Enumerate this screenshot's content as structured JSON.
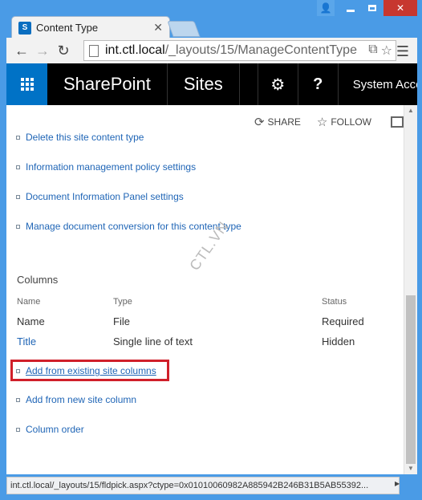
{
  "browser": {
    "tab_title": "Content Type",
    "tab_favicon": "S",
    "url_host": "int.ctl.local",
    "url_path": "/_layouts/15/ManageContentType",
    "status_url": "int.ctl.local/_layouts/15/fldpick.aspx?ctype=0x01010060982A885942B246B31B5AB55392..."
  },
  "suite": {
    "brand": "SharePoint",
    "sites": "Sites",
    "settings_icon": "⚙",
    "help_icon": "?",
    "account": "System Account"
  },
  "ribbon": {
    "share": "SHARE",
    "follow": "FOLLOW"
  },
  "settings_links": [
    "Delete this site content type",
    "Information management policy settings",
    "Document Information Panel settings",
    "Manage document conversion for this content type"
  ],
  "columns": {
    "title": "Columns",
    "headers": {
      "name": "Name",
      "type": "Type",
      "status": "Status"
    },
    "rows": [
      {
        "name": "Name",
        "type": "File",
        "status": "Required"
      },
      {
        "name": "Title",
        "type": "Single line of text",
        "status": "Hidden"
      }
    ]
  },
  "column_links": [
    "Add from existing site columns",
    "Add from new site column",
    "Column order"
  ],
  "watermark": "CTL.VN",
  "colors": {
    "accent": "#0072c6",
    "highlight": "#d0202a",
    "suite_bg": "#000000"
  }
}
